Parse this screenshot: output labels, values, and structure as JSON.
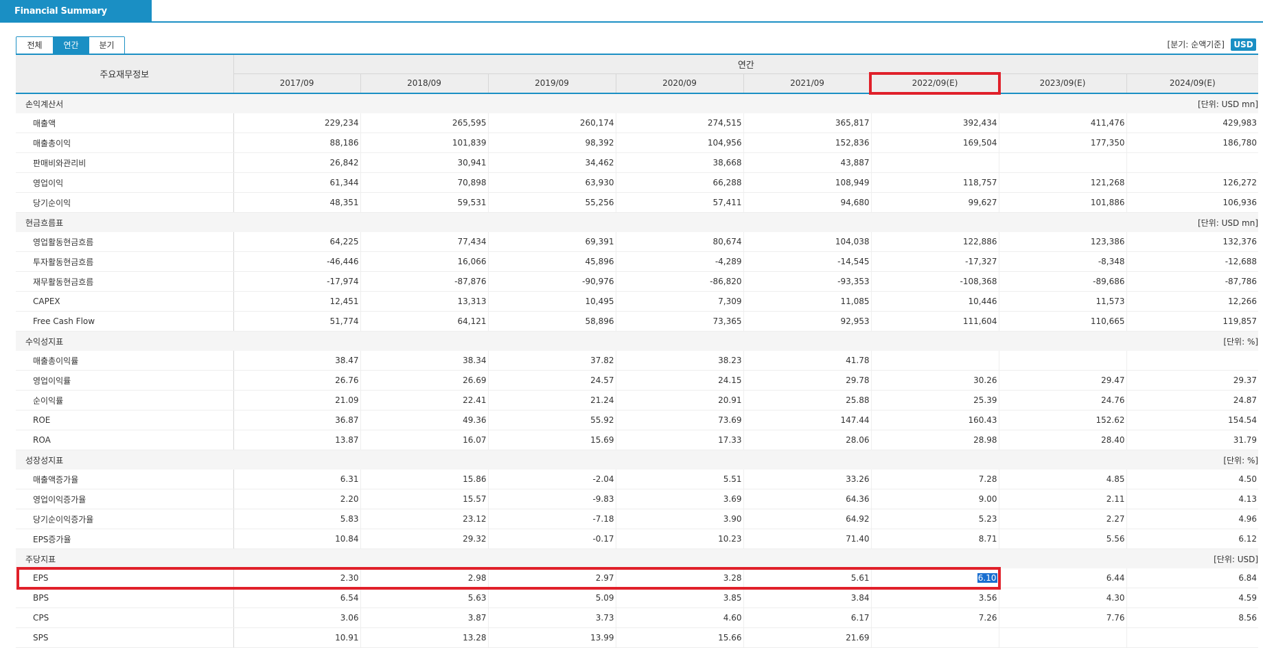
{
  "header": {
    "tab_title": "Financial Summary"
  },
  "period_tabs": [
    {
      "label": "전체",
      "active": false
    },
    {
      "label": "연간",
      "active": true
    },
    {
      "label": "분기",
      "active": false
    }
  ],
  "basis_text": "[분기: 순액기준]",
  "currency_label": "USD",
  "table": {
    "corner_label": "주요재무정보",
    "group_label": "연간",
    "years": [
      "2017/09",
      "2018/09",
      "2019/09",
      "2020/09",
      "2021/09",
      "2022/09(E)",
      "2023/09(E)",
      "2024/09(E)"
    ],
    "sections": [
      {
        "name": "손익계산서",
        "unit": "[단위: USD mn]",
        "rows": [
          {
            "label": "매출액",
            "values": [
              "229,234",
              "265,595",
              "260,174",
              "274,515",
              "365,817",
              "392,434",
              "411,476",
              "429,983"
            ]
          },
          {
            "label": "매출총이익",
            "values": [
              "88,186",
              "101,839",
              "98,392",
              "104,956",
              "152,836",
              "169,504",
              "177,350",
              "186,780"
            ]
          },
          {
            "label": "판매비와관리비",
            "values": [
              "26,842",
              "30,941",
              "34,462",
              "38,668",
              "43,887",
              "",
              "",
              ""
            ]
          },
          {
            "label": "영업이익",
            "values": [
              "61,344",
              "70,898",
              "63,930",
              "66,288",
              "108,949",
              "118,757",
              "121,268",
              "126,272"
            ]
          },
          {
            "label": "당기순이익",
            "values": [
              "48,351",
              "59,531",
              "55,256",
              "57,411",
              "94,680",
              "99,627",
              "101,886",
              "106,936"
            ]
          }
        ]
      },
      {
        "name": "현금흐름표",
        "unit": "[단위: USD mn]",
        "rows": [
          {
            "label": "영업활동현금흐름",
            "values": [
              "64,225",
              "77,434",
              "69,391",
              "80,674",
              "104,038",
              "122,886",
              "123,386",
              "132,376"
            ]
          },
          {
            "label": "투자활동현금흐름",
            "values": [
              "-46,446",
              "16,066",
              "45,896",
              "-4,289",
              "-14,545",
              "-17,327",
              "-8,348",
              "-12,688"
            ]
          },
          {
            "label": "재무활동현금흐름",
            "values": [
              "-17,974",
              "-87,876",
              "-90,976",
              "-86,820",
              "-93,353",
              "-108,368",
              "-89,686",
              "-87,786"
            ]
          },
          {
            "label": "CAPEX",
            "values": [
              "12,451",
              "13,313",
              "10,495",
              "7,309",
              "11,085",
              "10,446",
              "11,573",
              "12,266"
            ]
          },
          {
            "label": "Free Cash Flow",
            "values": [
              "51,774",
              "64,121",
              "58,896",
              "73,365",
              "92,953",
              "111,604",
              "110,665",
              "119,857"
            ]
          }
        ]
      },
      {
        "name": "수익성지표",
        "unit": "[단위: %]",
        "rows": [
          {
            "label": "매출총이익률",
            "values": [
              "38.47",
              "38.34",
              "37.82",
              "38.23",
              "41.78",
              "",
              "",
              ""
            ]
          },
          {
            "label": "영업이익률",
            "values": [
              "26.76",
              "26.69",
              "24.57",
              "24.15",
              "29.78",
              "30.26",
              "29.47",
              "29.37"
            ]
          },
          {
            "label": "순이익률",
            "values": [
              "21.09",
              "22.41",
              "21.24",
              "20.91",
              "25.88",
              "25.39",
              "24.76",
              "24.87"
            ]
          },
          {
            "label": "ROE",
            "values": [
              "36.87",
              "49.36",
              "55.92",
              "73.69",
              "147.44",
              "160.43",
              "152.62",
              "154.54"
            ]
          },
          {
            "label": "ROA",
            "values": [
              "13.87",
              "16.07",
              "15.69",
              "17.33",
              "28.06",
              "28.98",
              "28.40",
              "31.79"
            ]
          }
        ]
      },
      {
        "name": "성장성지표",
        "unit": "[단위: %]",
        "rows": [
          {
            "label": "매출액증가율",
            "values": [
              "6.31",
              "15.86",
              "-2.04",
              "5.51",
              "33.26",
              "7.28",
              "4.85",
              "4.50"
            ]
          },
          {
            "label": "영업이익증가율",
            "values": [
              "2.20",
              "15.57",
              "-9.83",
              "3.69",
              "64.36",
              "9.00",
              "2.11",
              "4.13"
            ]
          },
          {
            "label": "당기순이익증가율",
            "values": [
              "5.83",
              "23.12",
              "-7.18",
              "3.90",
              "64.92",
              "5.23",
              "2.27",
              "4.96"
            ]
          },
          {
            "label": "EPS증가율",
            "values": [
              "10.84",
              "29.32",
              "-0.17",
              "10.23",
              "71.40",
              "8.71",
              "5.56",
              "6.12"
            ]
          }
        ]
      },
      {
        "name": "주당지표",
        "unit": "[단위: USD]",
        "rows": [
          {
            "label": "EPS",
            "values": [
              "2.30",
              "2.98",
              "2.97",
              "3.28",
              "5.61",
              "6.10",
              "6.44",
              "6.84"
            ]
          },
          {
            "label": "BPS",
            "values": [
              "6.54",
              "5.63",
              "5.09",
              "3.85",
              "3.84",
              "3.56",
              "4.30",
              "4.59"
            ]
          },
          {
            "label": "CPS",
            "values": [
              "3.06",
              "3.87",
              "3.73",
              "4.60",
              "6.17",
              "7.26",
              "7.76",
              "8.56"
            ]
          },
          {
            "label": "SPS",
            "values": [
              "10.91",
              "13.28",
              "13.99",
              "15.66",
              "21.69",
              "",
              "",
              ""
            ]
          }
        ]
      }
    ]
  },
  "highlight": {
    "column": "2022/09(E)",
    "row": "EPS",
    "selected_cell": "6.10",
    "color": "#e0202a"
  }
}
